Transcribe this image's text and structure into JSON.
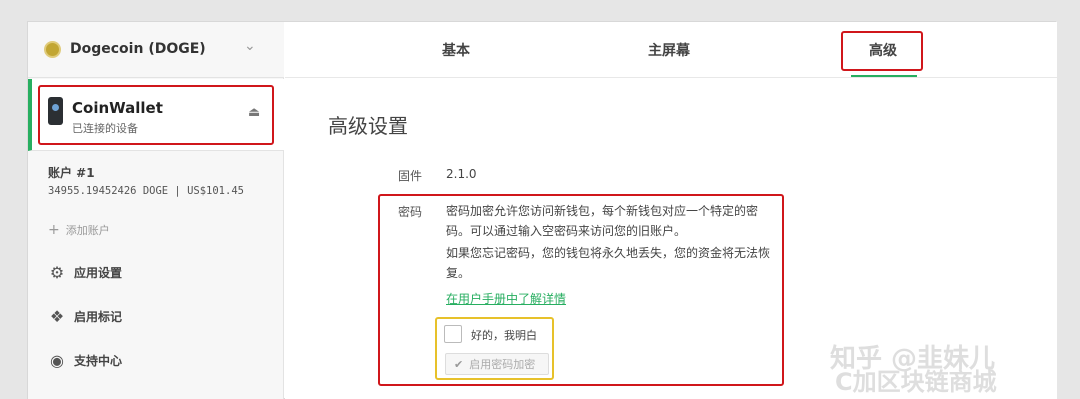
{
  "sidebar": {
    "coin": {
      "name": "Dogecoin (DOGE)",
      "icon": "dogecoin-logo"
    },
    "device": {
      "name": "CoinWallet",
      "status": "已连接的设备",
      "icon": "hardware-wallet-icon"
    },
    "account": {
      "label": "账户 #1",
      "balance": "34955.19452426 DOGE | US$101.45"
    },
    "add_account": "添加账户",
    "items": [
      {
        "label": "应用设置",
        "icon": "gear-icon"
      },
      {
        "label": "启用标记",
        "icon": "dropbox-icon"
      },
      {
        "label": "支持中心",
        "icon": "lifebuoy-icon"
      }
    ]
  },
  "tabs": [
    {
      "label": "基本"
    },
    {
      "label": "主屏幕"
    },
    {
      "label": "高级",
      "active": true
    }
  ],
  "main": {
    "title": "高级设置",
    "firmware_label": "固件",
    "firmware_value": "2.1.0",
    "password_label": "密码",
    "password_desc1": "密码加密允许您访问新钱包，每个新钱包对应一个特定的密码。可以通过输入空密码来访问您的旧账户。",
    "password_desc2": "如果您忘记密码，您的钱包将永久地丢失，您的资金将无法恢复。",
    "learn_more_link": "在用户手册中了解详情",
    "confirm_checkbox_label": "好的，我明白",
    "enable_button_label": "启用密码加密"
  },
  "watermark": {
    "line1": "知乎 @韭妹儿",
    "line2": "C加区块链商城"
  },
  "colors": {
    "accent": "#27ae60",
    "highlight_red": "#d0161b",
    "highlight_yellow": "#e7c12a"
  }
}
